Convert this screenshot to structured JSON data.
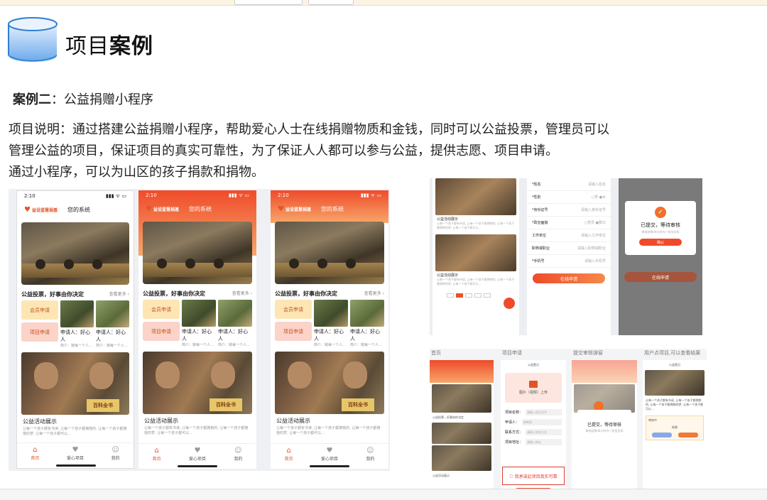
{
  "header": {
    "title_normal": "项目",
    "title_bold": "案例"
  },
  "case": {
    "label": "案例二",
    "sep": "：",
    "name": "公益捐赠小程序"
  },
  "description": {
    "line1": "项目说明：通过搭建公益捐赠小程序，帮助爱心人士在线捐赠物质和金钱，同时可以公益投票，管理员可以",
    "line2": "管理公益的项目，保证项目的真实可靠性，为了保证人人都可以参与公益，提供志愿、项目申请。",
    "line3": "通过小程序，可以为山区的孩子捐款和捐物。"
  },
  "phone": {
    "time": "2:10",
    "signal": "▮▮▮ ᯤ ▭",
    "logo_text": "益设蓝慧捐基",
    "nav_title": "您的系统",
    "section_title": "公益投票，好事由你决定",
    "section_more": "查看更多 ›",
    "btn_member": "会员申请",
    "btn_project": "项目申请",
    "applicant1_name": "申请人：好心人",
    "applicant1_sub": "简介：链每一个人…",
    "applicant2_name": "申请人：好心人",
    "applicant2_sub": "简介：链每一个人…",
    "book_text": "百科全书",
    "activity_title": "公益活动展示",
    "activity_text": "让每一个孩子都有书读, 让每一个孩子都拥抱的, 让每一个孩子都拥抱的梦, 让每一个孩子都可以…",
    "tabs": [
      {
        "label": "首页",
        "icon": "⌂"
      },
      {
        "label": "爱心项目",
        "icon": "♥"
      },
      {
        "label": "我的",
        "icon": "☺"
      }
    ]
  },
  "form": {
    "fields": [
      {
        "label": "*姓名",
        "ph": "请输入姓名"
      },
      {
        "label": "*性别",
        "ph": "○男  ●女"
      },
      {
        "label": "*身份证号",
        "ph": "请输入身份证号"
      },
      {
        "label": "*政治面貌",
        "ph": "○党员  ●群众"
      },
      {
        "label": "工作单位",
        "ph": "请输入工作单位"
      },
      {
        "label": "职称或职业",
        "ph": "请输入职称或职业"
      },
      {
        "label": "*手机号",
        "ph": "请输入手机号"
      }
    ],
    "submit": "在线申请"
  },
  "review_modal": {
    "title": "已提交，等待审核",
    "sub": "审核结果48小时内一短信告知",
    "btn": "确认"
  },
  "bottom": {
    "cap1": "首页",
    "cap2": "项目申请",
    "cap3": "提交审核弹窗",
    "cap4": "用户点项目,可以查看结果",
    "c2_title": "公益登记",
    "upload_label": "图片（视频）上传",
    "row_name": "项目名称：",
    "row_name_ph": "请输入项目名字",
    "row_applicant": "申请人：",
    "row_applicant_ph": "梦吧吧",
    "row_contact": "联系方式：",
    "row_contact_ph": "请输入联系方式",
    "row_address": "项目地址：",
    "row_address_ph": "请输入地址",
    "note": "我承诺此项目真实可靠",
    "c3_title": "已提交，等待审核",
    "c3_sub": "审核结果48小时内一短信告知",
    "c4_title": "公益登记",
    "c4_card_title": "审核中",
    "c4_result": "结果"
  }
}
